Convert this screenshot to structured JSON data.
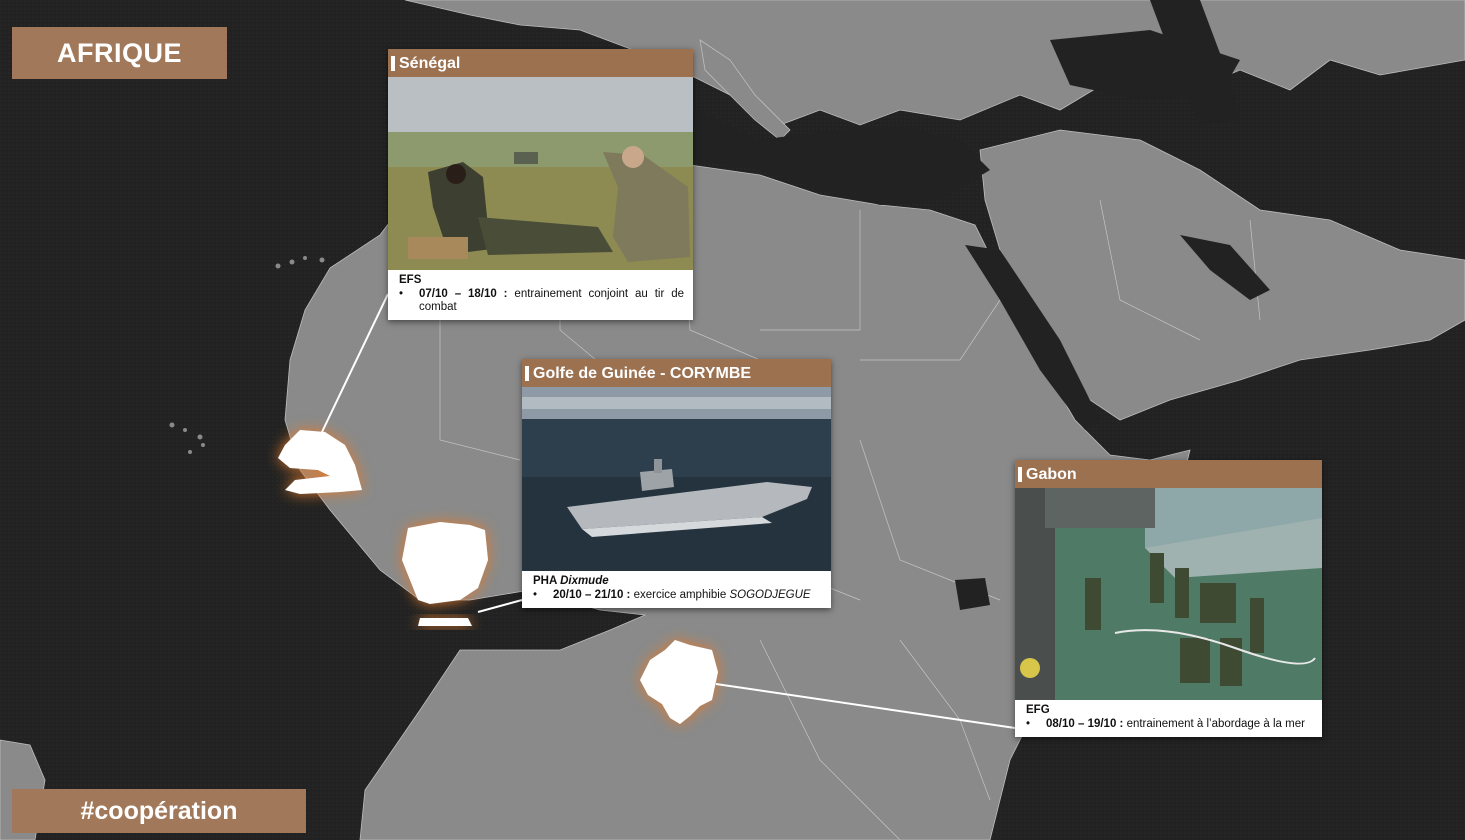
{
  "header": {
    "title": "AFRIQUE"
  },
  "footer": {
    "hashtag": "#coopération"
  },
  "colors": {
    "accent": "#a1795a",
    "map_land": "#8a8a8a",
    "map_sea": "#222222",
    "glow": "#e07a2a"
  },
  "cards": {
    "senegal": {
      "title": "Sénégal",
      "unit": "EFS",
      "bullet_dates": "07/10 – 18/10 :",
      "bullet_text": " entrainement conjoint au tir de combat"
    },
    "guinee": {
      "title": "Golfe de Guinée - CORYMBE",
      "unit_prefix": "PHA ",
      "unit_name": "Dixmude",
      "bullet_dates": "20/10 – 21/10 :",
      "bullet_text": " exercice amphibie ",
      "bullet_italic": "SOGODJEGUE"
    },
    "gabon": {
      "title": "Gabon",
      "unit": "EFG",
      "bullet_dates": "08/10 – 19/10 :",
      "bullet_text": " entrainement à l’abordage à la mer"
    }
  }
}
